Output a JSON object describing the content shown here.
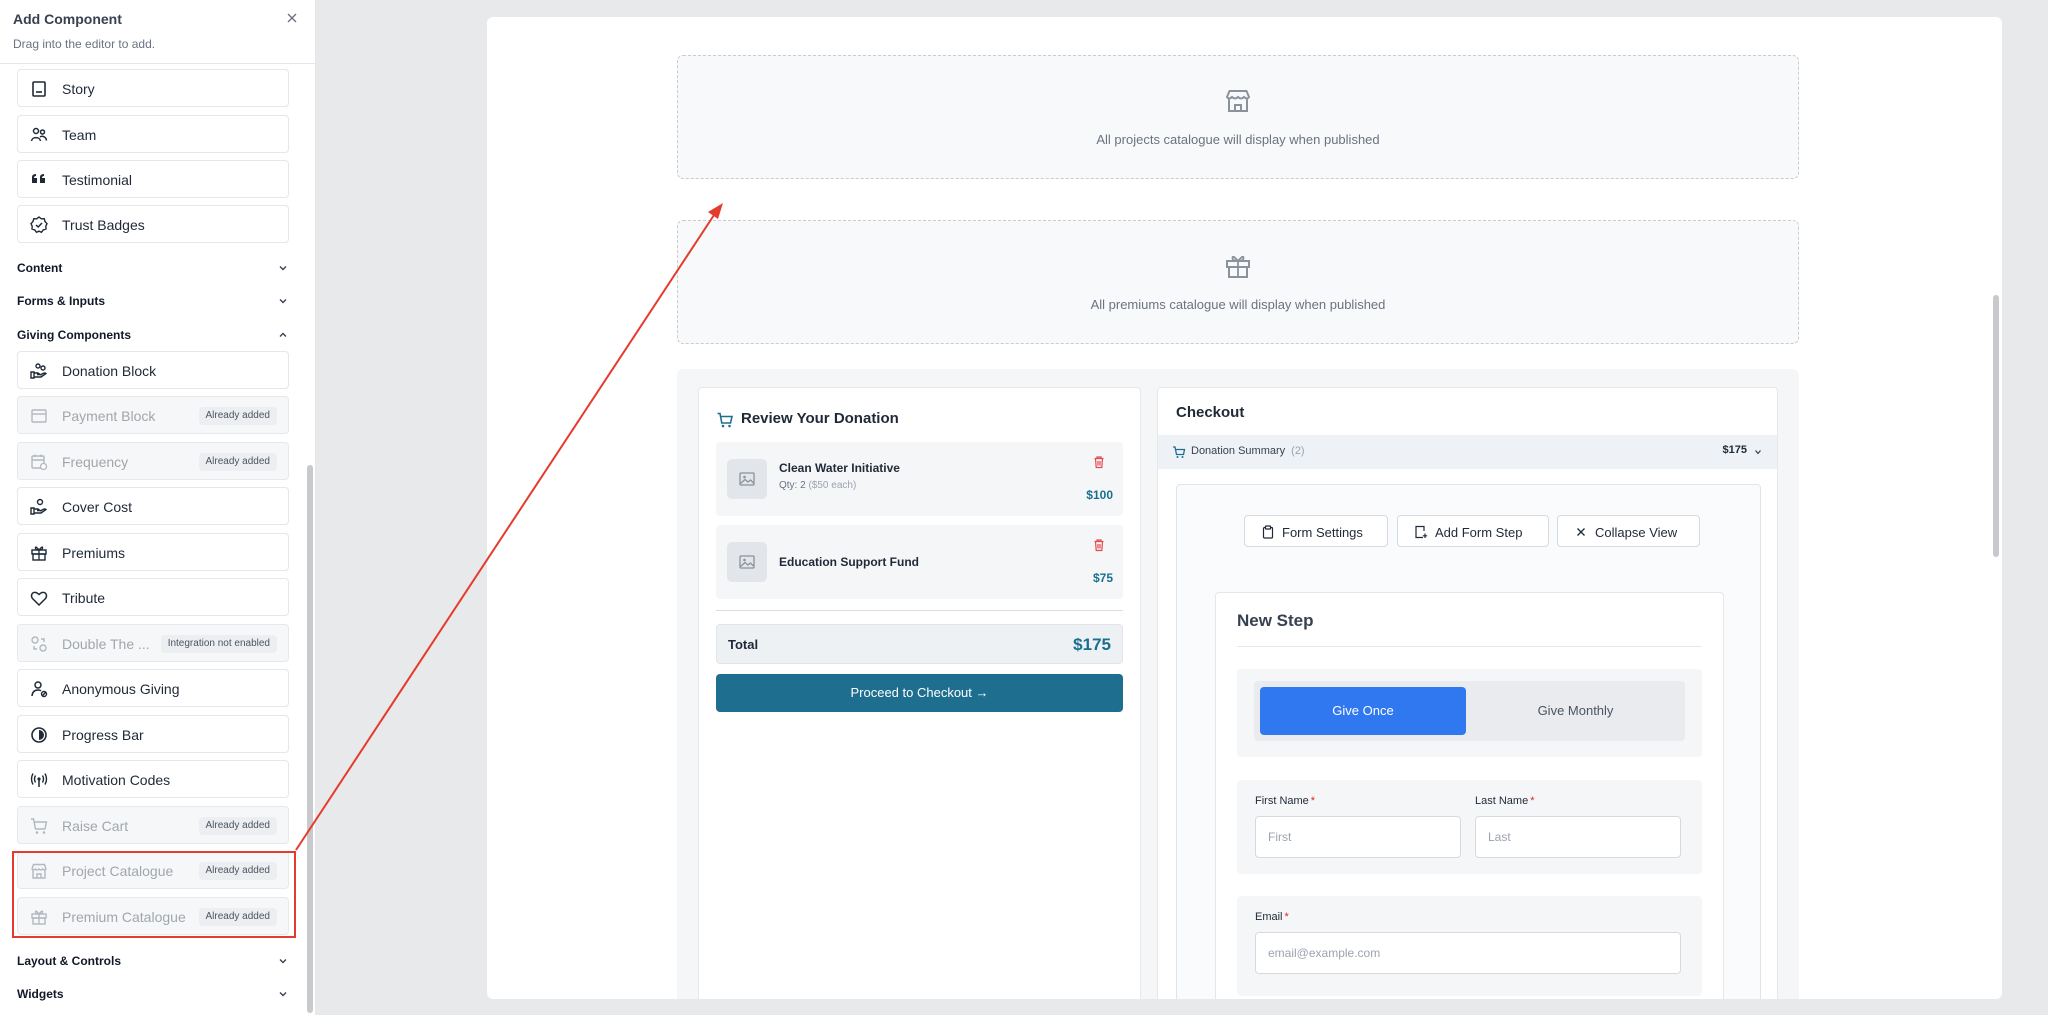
{
  "sidebar": {
    "title": "Add Component",
    "subtitle": "Drag into the editor to add.",
    "items_top": [
      {
        "label": "Story",
        "icon": "book-icon"
      },
      {
        "label": "Team",
        "icon": "team-icon"
      },
      {
        "label": "Testimonial",
        "icon": "quote-icon"
      },
      {
        "label": "Trust Badges",
        "icon": "badge-check-icon"
      }
    ],
    "sections": {
      "content": "Content",
      "forms": "Forms & Inputs",
      "giving": "Giving Components",
      "layout": "Layout & Controls",
      "widgets": "Widgets"
    },
    "giving_items": [
      {
        "label": "Donation Block",
        "icon": "hand-coins-icon",
        "badge": ""
      },
      {
        "label": "Payment Block",
        "icon": "payment-card-icon",
        "badge": "Already added"
      },
      {
        "label": "Frequency",
        "icon": "calendar-clock-icon",
        "badge": "Already added"
      },
      {
        "label": "Cover Cost",
        "icon": "hand-coins-icon",
        "badge": ""
      },
      {
        "label": "Premiums",
        "icon": "gift-icon",
        "badge": ""
      },
      {
        "label": "Tribute",
        "icon": "heart-icon",
        "badge": ""
      },
      {
        "label": "Double The ...",
        "icon": "link-icon",
        "badge": "Integration not enabled"
      },
      {
        "label": "Anonymous Giving",
        "icon": "user-hidden-icon",
        "badge": ""
      },
      {
        "label": "Progress Bar",
        "icon": "progress-circle-icon",
        "badge": ""
      },
      {
        "label": "Motivation Codes",
        "icon": "broadcast-icon",
        "badge": ""
      },
      {
        "label": "Raise Cart",
        "icon": "cart-icon",
        "badge": "Already added"
      },
      {
        "label": "Project Catalogue",
        "icon": "store-icon",
        "badge": "Already added"
      },
      {
        "label": "Premium Catalogue",
        "icon": "gift-icon",
        "badge": "Already added"
      }
    ]
  },
  "canvas": {
    "projects_placeholder": "All projects catalogue will display when published",
    "premiums_placeholder": "All premiums catalogue will display when published",
    "review": {
      "title": "Review Your Donation",
      "items": [
        {
          "name": "Clean Water Initiative",
          "qty": "Qty: 2",
          "each": "($50 each)",
          "price": "$100"
        },
        {
          "name": "Education Support Fund",
          "qty": "",
          "each": "",
          "price": "$75"
        }
      ],
      "total_label": "Total",
      "total_value": "$175",
      "checkout_button": "Proceed to Checkout →"
    },
    "checkout": {
      "title": "Checkout",
      "summary_label": "Donation Summary",
      "summary_count": "(2)",
      "summary_value": "$175",
      "toolbar": {
        "form_settings": "Form Settings",
        "add_form_step": "Add Form Step",
        "collapse_view": "Collapse View"
      },
      "step": {
        "title": "New Step",
        "give_once": "Give Once",
        "give_monthly": "Give Monthly",
        "first_name_label": "First Name",
        "first_name_placeholder": "First",
        "last_name_label": "Last Name",
        "last_name_placeholder": "Last",
        "email_label": "Email",
        "email_placeholder": "email@example.com",
        "required_mark": "*"
      }
    }
  },
  "colors": {
    "accent": "#1e6f8f",
    "primary_blue": "#2f78ef",
    "highlight": "#e53b2c",
    "danger": "#dc2626"
  }
}
